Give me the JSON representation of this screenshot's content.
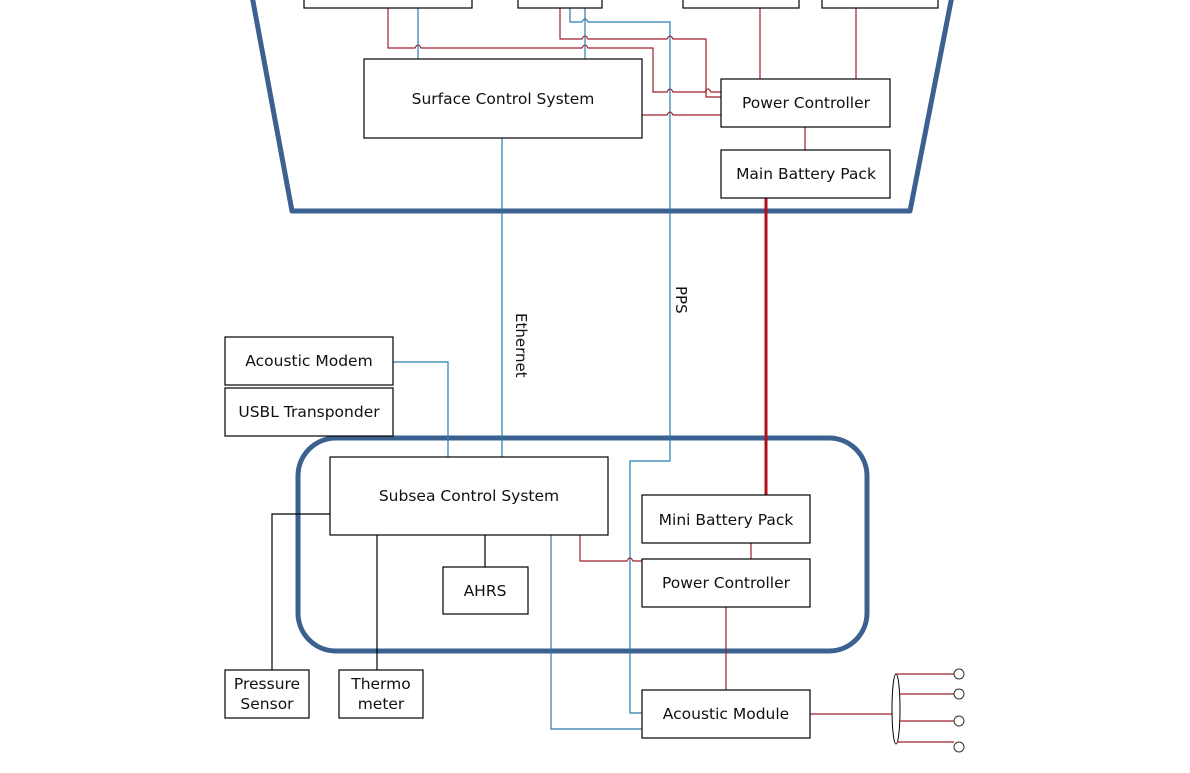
{
  "diagram": {
    "surface_vessel": {
      "top_boxes": [
        "",
        "",
        "",
        ""
      ],
      "surface_control_system": "Surface Control System",
      "power_controller": "Power Controller",
      "main_battery_pack": "Main Battery Pack"
    },
    "links": {
      "ethernet": "Ethernet",
      "pps": "PPS"
    },
    "external_devices": {
      "acoustic_modem": "Acoustic Modem",
      "usbl_transponder": "USBL Transponder",
      "pressure_sensor": [
        "Pressure",
        "Sensor"
      ],
      "thermometer": [
        "Thermo",
        "meter"
      ]
    },
    "subsea_unit": {
      "subsea_control_system": "Subsea Control System",
      "ahrs": "AHRS",
      "mini_battery_pack": "Mini Battery Pack",
      "power_controller": "Power Controller"
    },
    "acoustic_module": "Acoustic Module",
    "hydrophone_count": 4,
    "colors": {
      "hull": "#3b6190",
      "power_line": "#a01e2c",
      "main_power_line": "#b40f16",
      "signal_line": "#2b7ab0",
      "data_line": "#000000"
    }
  }
}
